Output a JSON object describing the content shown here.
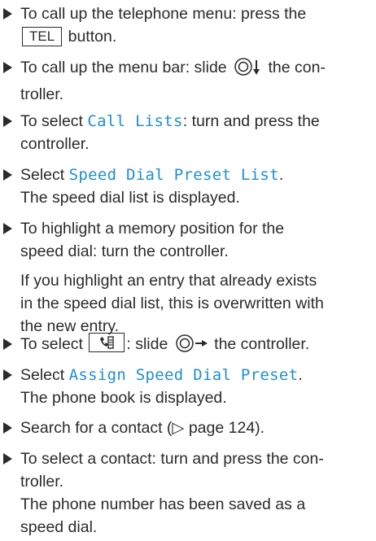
{
  "steps": [
    {
      "pre": "To call up the telephone menu: press the ",
      "key": "TEL",
      "post": " button."
    },
    {
      "pre": "To call up the menu bar: slide ",
      "post": " the con-",
      "cont": "troller."
    },
    {
      "pre": "To select ",
      "ui": "Call Lists",
      "post": ": turn and press the",
      "cont": "controller."
    },
    {
      "pre": "Select ",
      "ui": "Speed Dial Preset List",
      "post": ".",
      "sub": "The speed dial list is displayed."
    },
    {
      "pre": "To highlight a memory position for the",
      "cont": "speed dial: turn the controller.",
      "note": [
        "If you highlight an entry that already exists",
        "in the speed dial list, this is overwritten with",
        "the new entry."
      ]
    },
    {
      "pre": "To select ",
      "mid": ": slide ",
      "post": " the controller."
    },
    {
      "pre": "Select ",
      "ui": "Assign Speed Dial Preset",
      "post": ".",
      "sub": "The phone book is displayed."
    },
    {
      "pre": "Search for a contact (",
      "ref": "▷ page 124",
      "post": ")."
    },
    {
      "pre": "To select a contact: turn and press the con-",
      "cont": "troller.",
      "sub": "The phone number has been saved as a",
      "sub2": "speed dial."
    }
  ],
  "icons": {
    "controller_down": "controller-slide-down-icon",
    "controller_right": "controller-slide-right-icon",
    "phonebook_key": "phonebook-key-icon"
  }
}
